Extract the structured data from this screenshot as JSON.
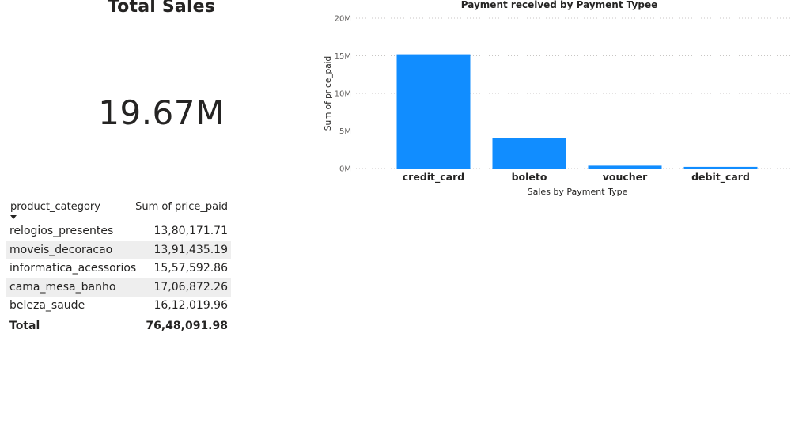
{
  "card": {
    "title": "Total Sales",
    "value": "19.67M"
  },
  "table": {
    "headers": [
      "product_category",
      "Sum of price_paid"
    ],
    "rows": [
      {
        "category": "relogios_presentes",
        "value": "13,80,171.71"
      },
      {
        "category": "moveis_decoracao",
        "value": "13,91,435.19"
      },
      {
        "category": "informatica_acessorios",
        "value": "15,57,592.86"
      },
      {
        "category": "cama_mesa_banho",
        "value": "17,06,872.26"
      },
      {
        "category": "beleza_saude",
        "value": "16,12,019.96"
      }
    ],
    "total_label": "Total",
    "total_value": "76,48,091.98"
  },
  "chart_data": {
    "type": "bar",
    "title": "Payment received by Payment Typee",
    "xlabel": "Sales by Payment Type",
    "ylabel": "Sum of price_paid",
    "categories": [
      "credit_card",
      "boleto",
      "voucher",
      "debit_card"
    ],
    "values": [
      15.2,
      4.0,
      0.38,
      0.22
    ],
    "value_unit": "M",
    "yticks": [
      "0M",
      "5M",
      "10M",
      "15M",
      "20M"
    ],
    "ylim": [
      0,
      20
    ],
    "grid": true,
    "colors": {
      "bar": "#118dff"
    }
  }
}
